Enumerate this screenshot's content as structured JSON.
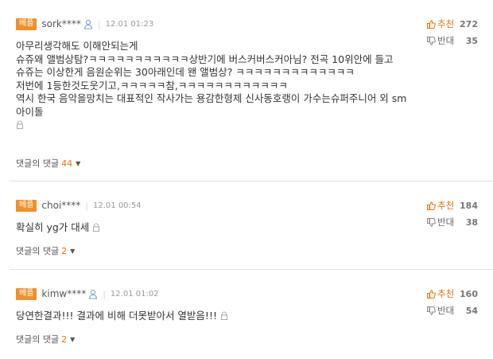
{
  "comments": [
    {
      "badge": "베플",
      "nickname": "sork****",
      "time": "12.01 01:23",
      "lines": [
        "아무리생각해도 이해안되는게",
        "슈쥬왜 앨범상탐?ㅋㅋㅋㅋㅋㅋㅋㅋㅋㅋㅋ상반기에 버스커버스커아님? 전곡 10위안에 들고",
        "슈쥬는 이상한게 음원순위는 30아래인데 왠 앨범상? ㅋㅋㅋㅋㅋㅋㅋㅋㅋㅋㅋㅋㅋ",
        "저번에 1등한것도웃기고,ㅋㅋㅋㅋㅋ참,ㅋㅋㅋㅋㅋㅋㅋㅋㅋㅋㅋㅋ",
        "역시 한국 음악을망치는 대표적인 작사가는 용감한형제 신사동호랭이 가수는슈퍼주니어 외 sm아이돌"
      ],
      "replies_label": "댓글의 댓글",
      "replies_count": "44",
      "up_label": "추천",
      "up_count": "272",
      "down_label": "반대",
      "down_count": "35"
    },
    {
      "badge": "베플",
      "nickname": "choi****",
      "time": "12.01 00:54",
      "lines": [
        "확실히 yg가 대세"
      ],
      "replies_label": "댓글의 댓글",
      "replies_count": "2",
      "up_label": "추천",
      "up_count": "184",
      "down_label": "반대",
      "down_count": "38"
    },
    {
      "badge": "베플",
      "nickname": "kimw****",
      "time": "12.01 01:02",
      "lines": [
        "당연한결과!!! 결과에 비해 더못받아서 열받음!!!"
      ],
      "replies_label": "댓글의 댓글",
      "replies_count": "2",
      "up_label": "추천",
      "up_count": "160",
      "down_label": "반대",
      "down_count": "54"
    }
  ],
  "colors": {
    "badge": "#f0902a",
    "accent": "#e4710c",
    "separator": "#e3e3e3"
  },
  "icons": {
    "user": "user-icon",
    "lock": "lock-icon",
    "up": "thumbs-up-icon",
    "down": "thumbs-down-icon"
  }
}
